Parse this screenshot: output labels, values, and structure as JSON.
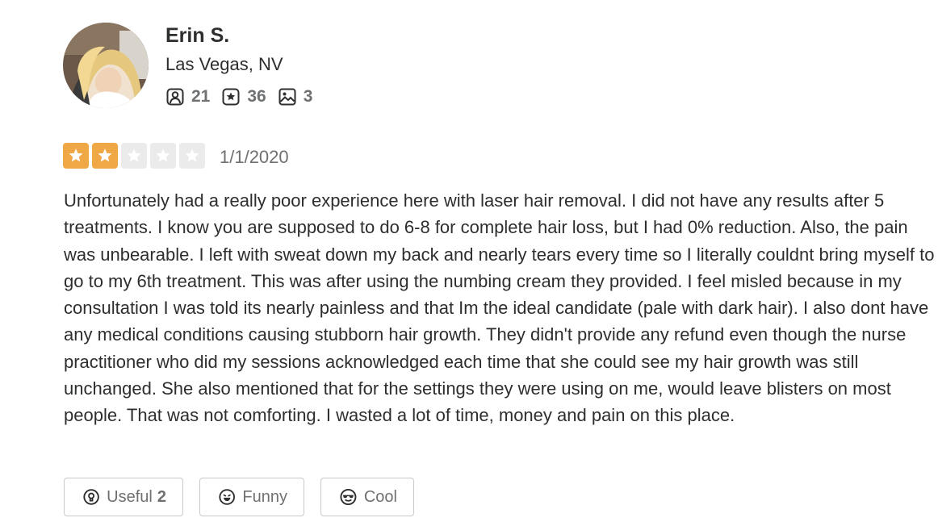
{
  "reviewer": {
    "name": "Erin S.",
    "location": "Las Vegas, NV",
    "stats": {
      "friends": "21",
      "reviews": "36",
      "photos": "3"
    }
  },
  "review": {
    "rating": 2,
    "max_rating": 5,
    "date": "1/1/2020",
    "text": "Unfortunately had a really poor experience here with laser hair removal. I did not have any results after 5 treatments. I know you are supposed to do 6-8 for complete hair loss, but I had 0% reduction. Also, the pain was unbearable. I left with sweat down my back and nearly tears every time so I literally couldnt bring myself to go to my 6th treatment. This was after using the numbing cream they provided. I feel misled because in my consultation I was told its nearly painless and that Im the ideal candidate (pale with dark hair). I also dont have any medical conditions causing stubborn hair growth. They didn't provide any refund even though the nurse practitioner who did my sessions acknowledged each time that she could see my hair growth was still unchanged. She also mentioned that for the settings they were using on me, would leave blisters on most people. That was not comforting. I wasted a lot of time, money and pain on this place."
  },
  "reactions": {
    "useful_label": "Useful",
    "useful_count": "2",
    "funny_label": "Funny",
    "cool_label": "Cool"
  },
  "colors": {
    "star_filled": "#f0a847",
    "star_empty": "#ebebeb",
    "text_primary": "#2d2e2f",
    "text_secondary": "#6e7072",
    "button_border": "#c8c9ca"
  }
}
